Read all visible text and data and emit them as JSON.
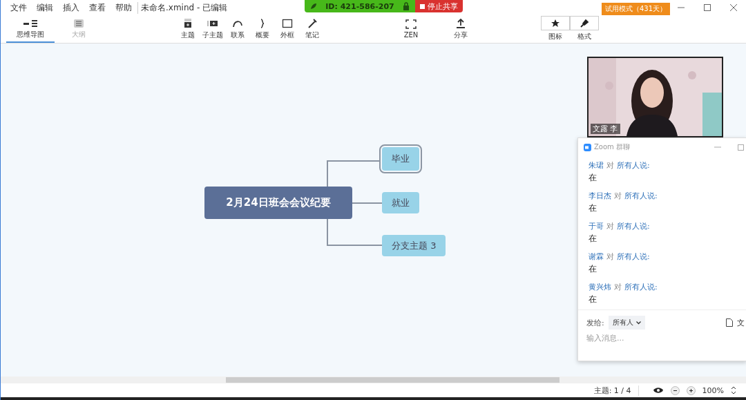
{
  "menu": [
    "文件",
    "编辑",
    "插入",
    "查看",
    "帮助"
  ],
  "doc_title": "未命名.xmind - 已编辑",
  "share_bar": {
    "meeting_id": "ID: 421-586-207",
    "stop": "停止共享"
  },
  "trial_badge": "试用模式（431天）",
  "view_tabs": [
    {
      "label": "思维导图",
      "selected": true
    },
    {
      "label": "大纲",
      "selected": false
    }
  ],
  "tools": [
    "主题",
    "子主题",
    "联系",
    "概要",
    "外框",
    "笔记"
  ],
  "center_tools": [
    "ZEN",
    "分享"
  ],
  "panel_tools": [
    "图标",
    "格式"
  ],
  "mindmap": {
    "central": "2月24日班会会议纪要",
    "branches": [
      {
        "label": "毕业",
        "selected": true
      },
      {
        "label": "就业",
        "selected": false
      },
      {
        "label": "分支主题 3",
        "selected": false
      }
    ]
  },
  "video": {
    "name": "文露 李"
  },
  "chat": {
    "title": "Zoom 群聊",
    "messages": [
      {
        "sender": "朱珺",
        "connector": "对",
        "recipient": "所有人说:",
        "text": "在"
      },
      {
        "sender": "李日杰",
        "connector": "对",
        "recipient": "所有人说:",
        "text": "在"
      },
      {
        "sender": "于哥",
        "connector": "对",
        "recipient": "所有人说:",
        "text": "在"
      },
      {
        "sender": "谢霖",
        "connector": "对",
        "recipient": "所有人说:",
        "text": "在"
      },
      {
        "sender": "黄兴炜",
        "connector": "对",
        "recipient": "所有人说:",
        "text": "在"
      }
    ],
    "send_to_label": "发给:",
    "send_to": "所有人",
    "file": "文",
    "placeholder": "输入消息..."
  },
  "status": {
    "topics": "主题: 1 / 4",
    "zoom": "100%"
  }
}
